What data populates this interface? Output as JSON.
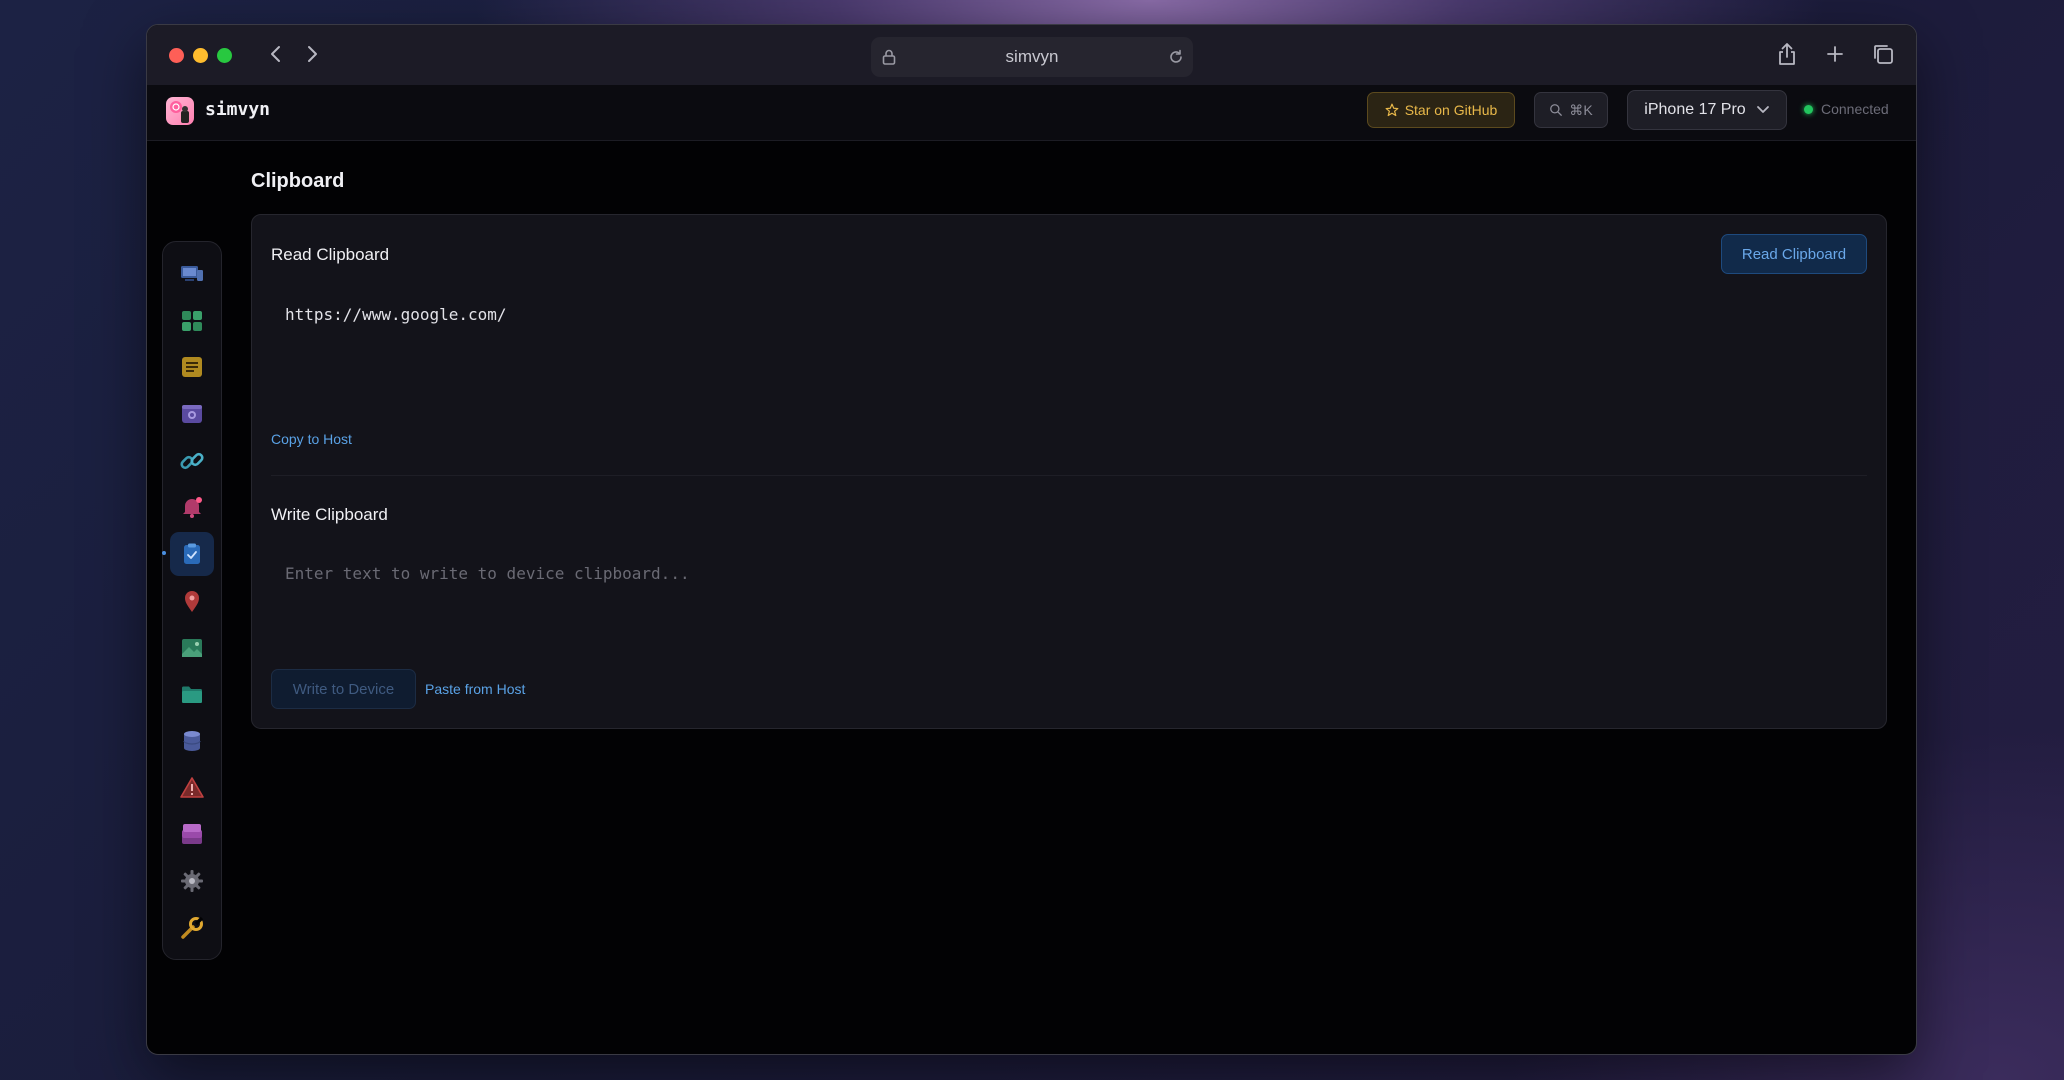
{
  "browser": {
    "url": "simvyn",
    "colors": {
      "close": "#fe5f57",
      "minimize": "#febc2e",
      "maximize": "#28c840"
    }
  },
  "header": {
    "brand": "simvyn",
    "github_label": "Star on GitHub",
    "search_shortcut": "⌘K",
    "device": "iPhone 17 Pro",
    "status": "Connected",
    "status_color": "#22c55e"
  },
  "sidebar": {
    "items": [
      {
        "icon": "devices-icon",
        "active": false
      },
      {
        "icon": "apps-grid-icon",
        "active": false
      },
      {
        "icon": "logs-icon",
        "active": false
      },
      {
        "icon": "screenshot-icon",
        "active": false
      },
      {
        "icon": "link-icon",
        "active": false
      },
      {
        "icon": "bell-icon",
        "active": false
      },
      {
        "icon": "clipboard-icon",
        "active": true
      },
      {
        "icon": "location-pin-icon",
        "active": false
      },
      {
        "icon": "image-icon",
        "active": false
      },
      {
        "icon": "folder-icon",
        "active": false
      },
      {
        "icon": "database-icon",
        "active": false
      },
      {
        "icon": "warning-icon",
        "active": false
      },
      {
        "icon": "stack-icon",
        "active": false
      },
      {
        "icon": "gear-icon",
        "active": false
      },
      {
        "icon": "wrench-icon",
        "active": false
      }
    ]
  },
  "main": {
    "title": "Clipboard",
    "read": {
      "title": "Read Clipboard",
      "button_label": "Read Clipboard",
      "value": "https://www.google.com/",
      "copy_label": "Copy to Host"
    },
    "write": {
      "title": "Write Clipboard",
      "placeholder": "Enter text to write to device clipboard...",
      "value": "",
      "write_label": "Write to Device",
      "paste_label": "Paste from Host"
    }
  }
}
